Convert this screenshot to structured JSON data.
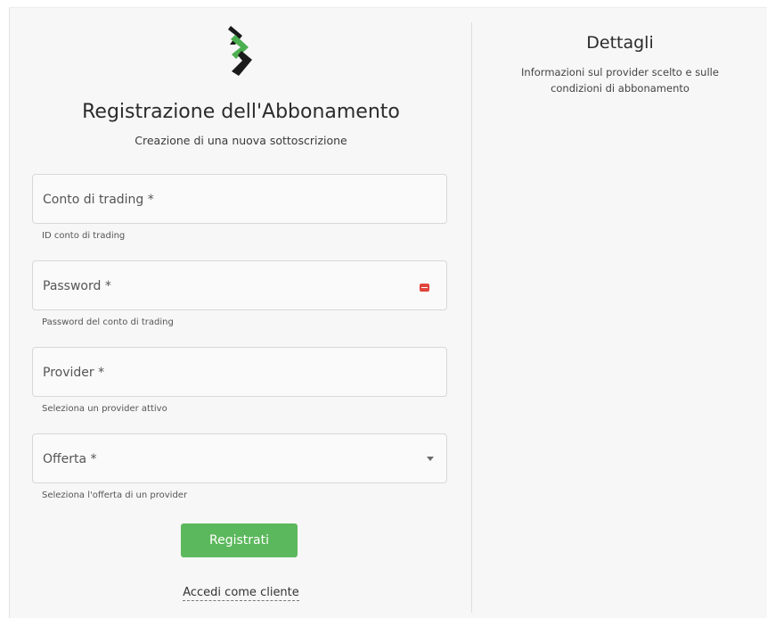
{
  "form": {
    "title": "Registrazione dell'Abbonamento",
    "subtitle": "Creazione di una nuova sottoscrizione",
    "fields": [
      {
        "label": "Conto di trading *",
        "helper": "ID conto di trading"
      },
      {
        "label": "Password *",
        "helper": "Password del conto di trading"
      },
      {
        "label": "Provider *",
        "helper": "Seleziona un provider attivo"
      },
      {
        "label": "Offerta *",
        "helper": "Seleziona l'offerta di un provider"
      }
    ],
    "submit_label": "Registrati",
    "login_link": "Accedi come cliente"
  },
  "details": {
    "title": "Dettagli",
    "text": "Informazioni sul provider scelto e sulle condizioni di abbonamento"
  },
  "colors": {
    "primary": "#5cb85c",
    "logo_green": "#4caf50",
    "logo_dark": "#1a1a1a",
    "password_icon": "#e0453c"
  },
  "icons": {
    "logo": "brand-logo-icon",
    "password": "password-keyboard-icon",
    "select": "chevron-down-icon"
  }
}
